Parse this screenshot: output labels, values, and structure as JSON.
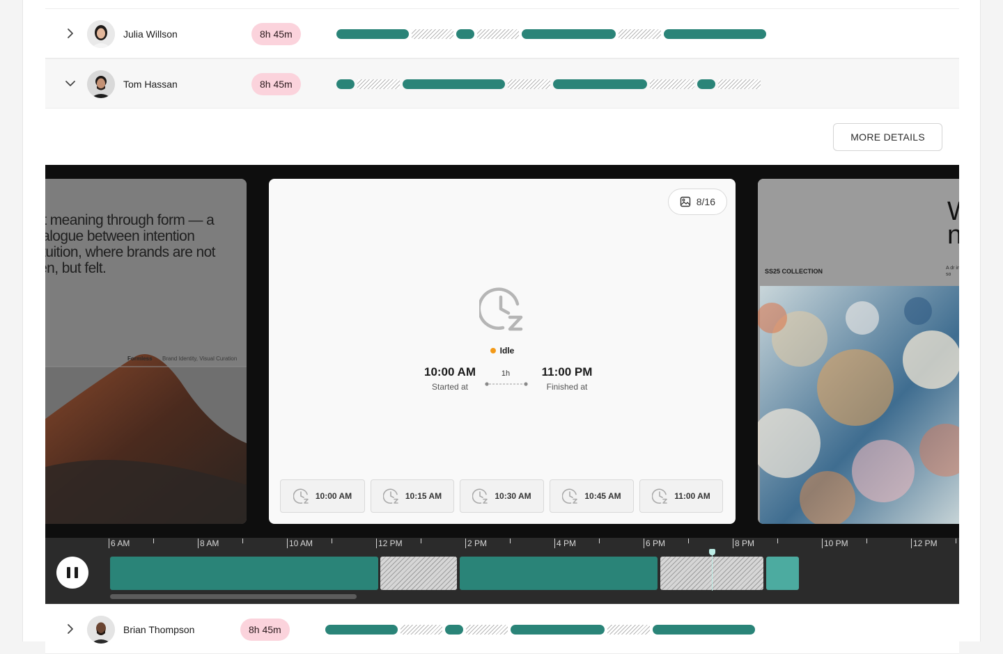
{
  "users": [
    {
      "name": "Julia Willson",
      "hours": "8h 45m",
      "expanded": false,
      "segments": [
        [
          "work",
          104
        ],
        [
          "idle",
          60
        ],
        [
          "work",
          26
        ],
        [
          "idle",
          60
        ],
        [
          "work",
          135
        ],
        [
          "idle",
          61
        ],
        [
          "work",
          147
        ]
      ]
    },
    {
      "name": "Tom Hassan",
      "hours": "8h 45m",
      "expanded": true,
      "segments": [
        [
          "work",
          26
        ],
        [
          "idle",
          61
        ],
        [
          "work",
          147
        ],
        [
          "idle",
          61
        ],
        [
          "work",
          135
        ],
        [
          "idle",
          64
        ],
        [
          "work",
          26
        ],
        [
          "idle",
          61
        ]
      ]
    },
    {
      "name": "Brian Thompson",
      "hours": "8h 45m",
      "expanded": false,
      "segments": [
        [
          "work",
          104
        ],
        [
          "idle",
          60
        ],
        [
          "work",
          26
        ],
        [
          "idle",
          60
        ],
        [
          "work",
          135
        ],
        [
          "idle",
          61
        ],
        [
          "work",
          147
        ]
      ]
    }
  ],
  "details": {
    "more_details_label": "MORE DETAILS",
    "counter": "8/16",
    "status": "Idle",
    "started_time": "10:00 AM",
    "started_label": "Started at",
    "finished_time": "11:00 PM",
    "finished_label": "Finished at",
    "duration": "1h",
    "thumbnails": [
      "10:00 AM",
      "10:15 AM",
      "10:30 AM",
      "10:45 AM",
      "11:00 AM"
    ]
  },
  "slides": {
    "left_text": "aft meaning through form — a dialogue between intention intuition, where brands are not een, but felt.",
    "left_caption_title": "Formless",
    "left_caption_sub": "Brand Identity, Visual Curation",
    "right_heading": "W n",
    "right_collection": "SS25 COLLECTION",
    "right_blurb": "A dr in so"
  },
  "timeline": {
    "labels": [
      "6 AM",
      "8 AM",
      "10 AM",
      "12 PM",
      "2 PM",
      "4 PM",
      "6 PM",
      "8 PM",
      "10 PM",
      "12 PM"
    ]
  },
  "colors": {
    "work": "#2a8478",
    "current": "#4caba0",
    "hours_badge": "#fbd3dc",
    "idle_dot": "#f39a19"
  }
}
